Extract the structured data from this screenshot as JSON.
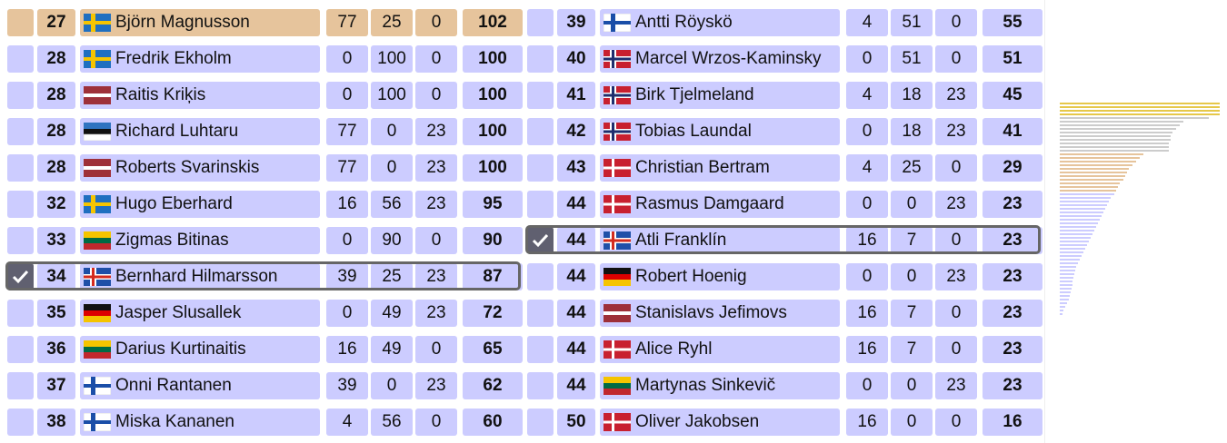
{
  "left_rows": [
    {
      "rank": "27",
      "flag": "SE",
      "name": "Björn Magnusson",
      "v1": "77",
      "v2": "25",
      "v3": "0",
      "total": "102",
      "gold": true,
      "selected": false
    },
    {
      "rank": "28",
      "flag": "SE",
      "name": "Fredrik Ekholm",
      "v1": "0",
      "v2": "100",
      "v3": "0",
      "total": "100",
      "gold": false,
      "selected": false
    },
    {
      "rank": "28",
      "flag": "LV",
      "name": "Raitis Kriķis",
      "v1": "0",
      "v2": "100",
      "v3": "0",
      "total": "100",
      "gold": false,
      "selected": false
    },
    {
      "rank": "28",
      "flag": "EE",
      "name": "Richard Luhtaru",
      "v1": "77",
      "v2": "0",
      "v3": "23",
      "total": "100",
      "gold": false,
      "selected": false
    },
    {
      "rank": "28",
      "flag": "LV",
      "name": "Roberts Svarinskis",
      "v1": "77",
      "v2": "0",
      "v3": "23",
      "total": "100",
      "gold": false,
      "selected": false
    },
    {
      "rank": "32",
      "flag": "SE",
      "name": "Hugo Eberhard",
      "v1": "16",
      "v2": "56",
      "v3": "23",
      "total": "95",
      "gold": false,
      "selected": false
    },
    {
      "rank": "33",
      "flag": "LT",
      "name": "Zigmas Bitinas",
      "v1": "0",
      "v2": "90",
      "v3": "0",
      "total": "90",
      "gold": false,
      "selected": false
    },
    {
      "rank": "34",
      "flag": "IS",
      "name": "Bernhard Hilmarsson",
      "v1": "39",
      "v2": "25",
      "v3": "23",
      "total": "87",
      "gold": false,
      "selected": true
    },
    {
      "rank": "35",
      "flag": "DE",
      "name": "Jasper Slusallek",
      "v1": "0",
      "v2": "49",
      "v3": "23",
      "total": "72",
      "gold": false,
      "selected": false
    },
    {
      "rank": "36",
      "flag": "LT",
      "name": "Darius Kurtinaitis",
      "v1": "16",
      "v2": "49",
      "v3": "0",
      "total": "65",
      "gold": false,
      "selected": false
    },
    {
      "rank": "37",
      "flag": "FI",
      "name": "Onni Rantanen",
      "v1": "39",
      "v2": "0",
      "v3": "23",
      "total": "62",
      "gold": false,
      "selected": false
    },
    {
      "rank": "38",
      "flag": "FI",
      "name": "Miska Kananen",
      "v1": "4",
      "v2": "56",
      "v3": "0",
      "total": "60",
      "gold": false,
      "selected": false
    }
  ],
  "right_rows": [
    {
      "rank": "39",
      "flag": "FI",
      "name": "Antti Röyskö",
      "v1": "4",
      "v2": "51",
      "v3": "0",
      "total": "55",
      "gold": false,
      "selected": false
    },
    {
      "rank": "40",
      "flag": "NO",
      "name": "Marcel Wrzos-Kaminsky",
      "v1": "0",
      "v2": "51",
      "v3": "0",
      "total": "51",
      "gold": false,
      "selected": false
    },
    {
      "rank": "41",
      "flag": "NO",
      "name": "Birk Tjelmeland",
      "v1": "4",
      "v2": "18",
      "v3": "23",
      "total": "45",
      "gold": false,
      "selected": false
    },
    {
      "rank": "42",
      "flag": "NO",
      "name": "Tobias Laundal",
      "v1": "0",
      "v2": "18",
      "v3": "23",
      "total": "41",
      "gold": false,
      "selected": false
    },
    {
      "rank": "43",
      "flag": "DK",
      "name": "Christian Bertram",
      "v1": "4",
      "v2": "25",
      "v3": "0",
      "total": "29",
      "gold": false,
      "selected": false
    },
    {
      "rank": "44",
      "flag": "DK",
      "name": "Rasmus Damgaard",
      "v1": "0",
      "v2": "0",
      "v3": "23",
      "total": "23",
      "gold": false,
      "selected": false
    },
    {
      "rank": "44",
      "flag": "IS",
      "name": "Atli Franklín",
      "v1": "16",
      "v2": "7",
      "v3": "0",
      "total": "23",
      "gold": false,
      "selected": true
    },
    {
      "rank": "44",
      "flag": "DE",
      "name": "Robert Hoenig",
      "v1": "0",
      "v2": "0",
      "v3": "23",
      "total": "23",
      "gold": false,
      "selected": false
    },
    {
      "rank": "44",
      "flag": "LV",
      "name": "Stanislavs Jefimovs",
      "v1": "16",
      "v2": "7",
      "v3": "0",
      "total": "23",
      "gold": false,
      "selected": false
    },
    {
      "rank": "44",
      "flag": "DK",
      "name": "Alice Ryhl",
      "v1": "16",
      "v2": "7",
      "v3": "0",
      "total": "23",
      "gold": false,
      "selected": false
    },
    {
      "rank": "44",
      "flag": "LT",
      "name": "Martynas Sinkevič",
      "v1": "0",
      "v2": "0",
      "v3": "23",
      "total": "23",
      "gold": false,
      "selected": false
    },
    {
      "rank": "50",
      "flag": "DK",
      "name": "Oliver Jakobsen",
      "v1": "16",
      "v2": "0",
      "v3": "0",
      "total": "16",
      "gold": false,
      "selected": false
    }
  ],
  "colors": {
    "gold": "#e6c49c",
    "silver": "#cccccc",
    "bronze": "#e6c49c",
    "row": "#ccccff",
    "selected_border": "#666666"
  },
  "chart_data": {
    "type": "bar",
    "orientation": "horizontal",
    "groups": [
      {
        "color": "#e6c84a",
        "values": [
          176,
          176,
          176,
          176
        ]
      },
      {
        "color": "#cccccc",
        "values": [
          164,
          136,
          132,
          128,
          124,
          122,
          122,
          120,
          120,
          120
        ]
      },
      {
        "color": "#e6c49c",
        "values": [
          92,
          88,
          84,
          80,
          76,
          74,
          72,
          70,
          66,
          64,
          62
        ]
      },
      {
        "color": "#ccccff",
        "values": [
          60,
          56,
          54,
          52,
          50,
          48,
          46,
          44,
          42,
          40,
          38,
          36,
          34,
          32,
          30,
          28,
          26,
          24,
          22,
          20,
          18,
          17,
          16,
          15,
          14,
          14,
          13,
          12,
          11,
          10,
          8,
          6,
          4,
          3
        ]
      }
    ]
  }
}
